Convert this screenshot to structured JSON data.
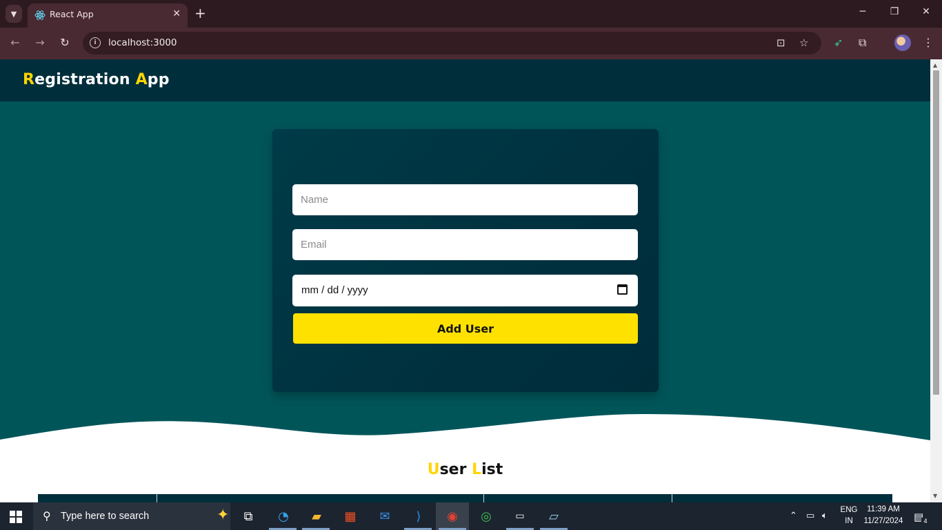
{
  "browser": {
    "tab_title": "React App",
    "url": "localhost:3000",
    "icons": {
      "tab_search": "chevron-down-icon",
      "new_tab": "plus-icon",
      "back": "arrow-left-icon",
      "forward": "arrow-right-icon",
      "reload": "reload-icon",
      "site_info": "info-icon",
      "install": "install-app-icon",
      "bookmark": "star-icon",
      "extension": "puzzle-icon",
      "menu": "kebab-menu-icon"
    }
  },
  "app": {
    "title_first_letter": "R",
    "title_rest_1": "egistration ",
    "title_second_letter": "A",
    "title_rest_2": "pp",
    "form": {
      "name_placeholder": "Name",
      "email_placeholder": "Email",
      "date_placeholder": "mm / dd / yyyy",
      "submit_label": "Add User"
    },
    "list_title_first_letter": "U",
    "list_title_rest_1": "ser ",
    "list_title_second_letter": "L",
    "list_title_rest_2": "ist",
    "colors": {
      "page_bg": "#005559",
      "header_bg": "#002e3b",
      "accent": "#ffd500",
      "button": "#ffe100"
    }
  },
  "taskbar": {
    "search_placeholder": "Type here to search",
    "language_top": "ENG",
    "language_bottom": "IN",
    "time": "11:39 AM",
    "date": "11/27/2024",
    "notification_count": "4"
  }
}
